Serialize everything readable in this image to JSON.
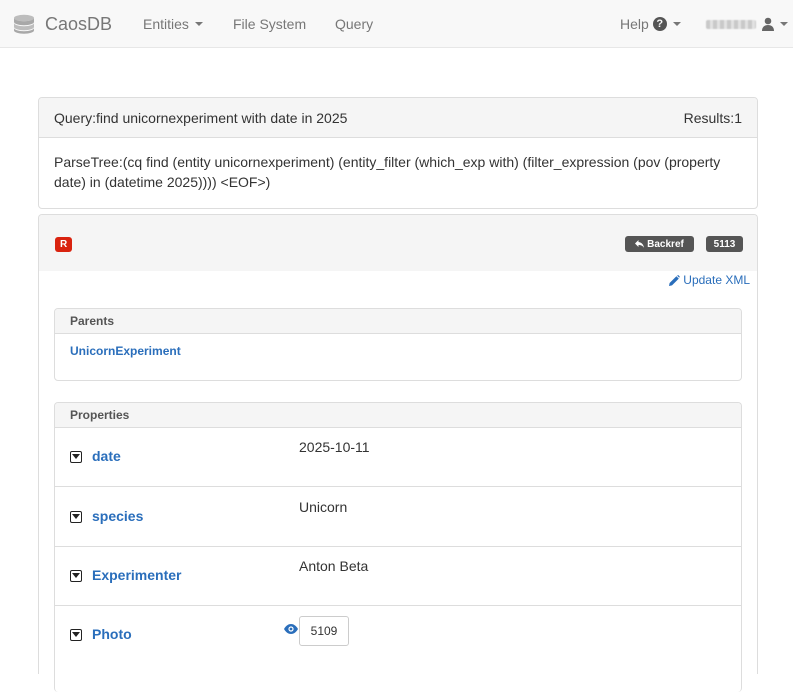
{
  "navbar": {
    "brand": "CaosDB",
    "entities_label": "Entities",
    "filesystem_label": "File System",
    "query_label": "Query",
    "help_label": "Help"
  },
  "query_panel": {
    "query_label": "Query:",
    "query_text": "find unicornexperiment with date in 2025",
    "results_label": "Results:",
    "results_count": "1",
    "parse_tree_label": "ParseTree:",
    "parse_tree": "(cq find (entity unicornexperiment) (entity_filter (which_exp with) (filter_expression (pov (property date) in (datetime 2025)))) <EOF>)"
  },
  "entity": {
    "role": "R",
    "backref_label": "Backref",
    "id": "5113",
    "update_xml_label": "Update XML",
    "parents_heading": "Parents",
    "parents": [
      "UnicornExperiment"
    ],
    "properties_heading": "Properties",
    "properties": [
      {
        "name": "date",
        "value": "2025-10-11"
      },
      {
        "name": "species",
        "value": "Unicorn"
      },
      {
        "name": "Experimenter",
        "value": "Anton Beta"
      },
      {
        "name": "Photo",
        "value": "5109"
      }
    ]
  },
  "colors": {
    "link": "#2a6ebb",
    "role_badge": "#d9230f",
    "badge_dark": "#555555",
    "navbar_bg": "#f8f8f8"
  }
}
